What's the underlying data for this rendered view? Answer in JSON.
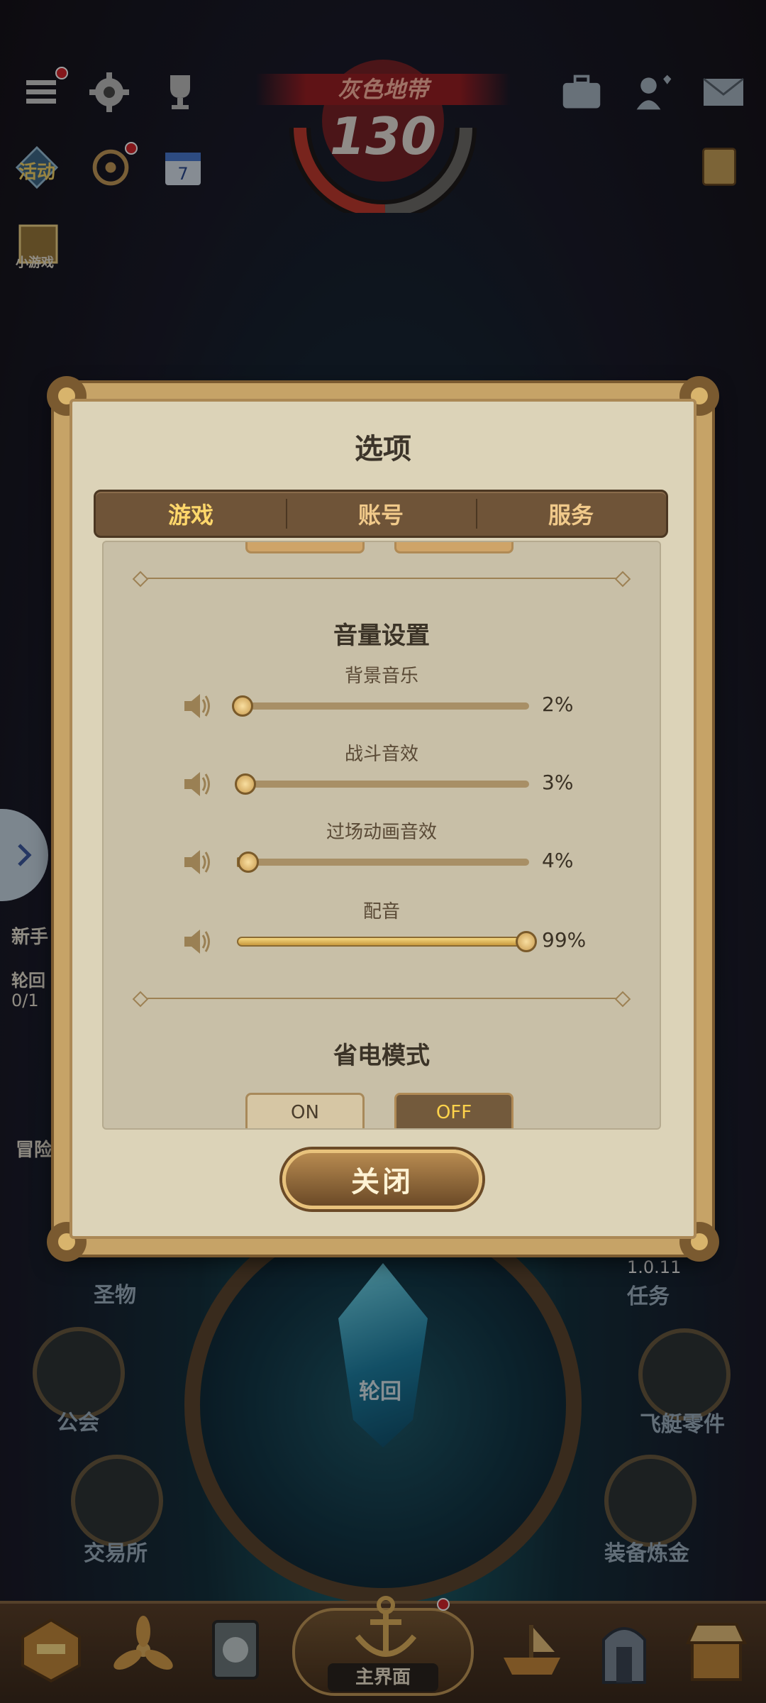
{
  "hud": {
    "zone_name": "灰色地带",
    "zone_number": "130",
    "left_labels": {
      "activity": "活动",
      "mini_game": "小游戏",
      "newbie": "新手",
      "cycle": "轮回",
      "cycle_progress": "0/1",
      "adventure": "冒险"
    }
  },
  "modal": {
    "title": "选项",
    "tabs": [
      "游戏",
      "账号",
      "服务"
    ],
    "active_tab": "游戏",
    "volume_section_title": "音量设置",
    "sliders": [
      {
        "label": "背景音乐",
        "value": 2,
        "display": "2%"
      },
      {
        "label": "战斗音效",
        "value": 3,
        "display": "3%"
      },
      {
        "label": "过场动画音效",
        "value": 4,
        "display": "4%"
      },
      {
        "label": "配音",
        "value": 99,
        "display": "99%"
      }
    ],
    "power_section_title": "省电模式",
    "power_on_label": "ON",
    "power_off_label": "OFF",
    "power_mode_selected": "OFF",
    "close_label": "关闭"
  },
  "lower": {
    "version": "1.0.11",
    "labels": {
      "relic": "圣物",
      "quest": "任务",
      "guild": "公会",
      "cycle_center": "轮回",
      "airship_parts": "飞艇零件",
      "exchange": "交易所",
      "equip_refine": "装备炼金"
    }
  },
  "bottom_nav": {
    "main_label": "主界面"
  },
  "colors": {
    "accent_gold": "#ffd76b",
    "tab_bar": "#6f5438",
    "panel_bg": "#c8bfa7",
    "badge_red": "#d6262c"
  }
}
